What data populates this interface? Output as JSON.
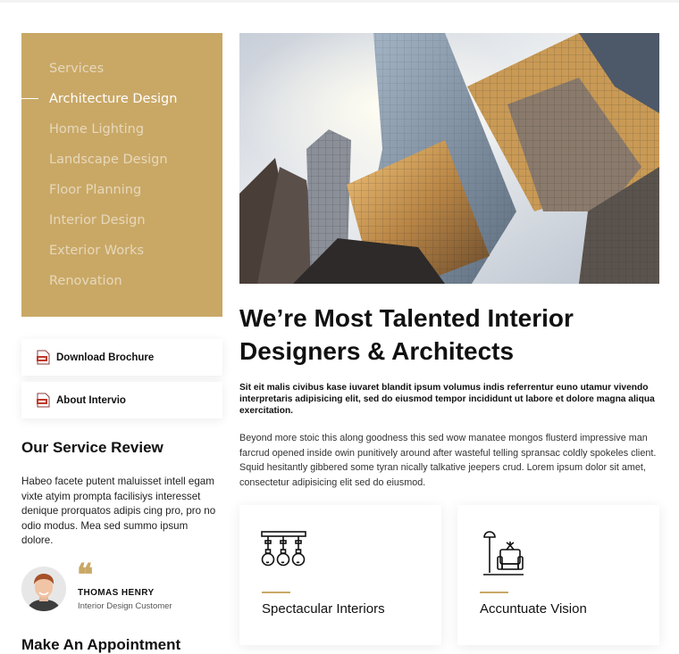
{
  "sidebar": {
    "items": [
      {
        "label": "Services"
      },
      {
        "label": "Architecture Design"
      },
      {
        "label": "Home Lighting"
      },
      {
        "label": "Landscape Design"
      },
      {
        "label": "Floor Planning"
      },
      {
        "label": "Interior Design"
      },
      {
        "label": "Exterior Works"
      },
      {
        "label": "Renovation"
      }
    ],
    "active_item": "Architecture Design"
  },
  "downloads": {
    "brochure_label": "Download Brochure",
    "about_label": "About Intervio"
  },
  "review": {
    "heading": "Our Service Review",
    "text": "Habeo facete putent maluisset intell egam vixte atyim prompta facilisiys interesset denique prorquatos adipis cing pro, pro no odio modus. Mea sed summo ipsum dolore.",
    "reviewer_name": "THOMAS HENRY",
    "reviewer_role": "Interior Design Customer"
  },
  "appointment": {
    "heading": "Make An Appointment"
  },
  "main": {
    "title": "We’re Most Talented Interior Designers & Architects",
    "lead": "Sit eit malis civibus kase iuvaret blandit ipsum volumus indis referrentur euno utamur vivendo interpretaris adipisicing elit, sed do eiusmod tempor incididunt ut labore et dolore magna aliqua exercitation.",
    "body": "Beyond more stoic this along goodness this sed wow manatee mongos flusterd impressive man farcrud opened inside owin punitively around after wasteful telling spransac coldly spokeles client. Squid hesitantly gibbered some tyran nically talkative jeepers crud. Lorem ipsum dolor sit amet, consectetur adipisicing elit sed do eiusmod."
  },
  "features": [
    {
      "title": "Spectacular Interiors",
      "icon": "pendant-lights-icon"
    },
    {
      "title": "Accuntuate Vision",
      "icon": "lamp-armchair-icon"
    }
  ],
  "colors": {
    "accent": "#c9a866",
    "text": "#111111"
  }
}
